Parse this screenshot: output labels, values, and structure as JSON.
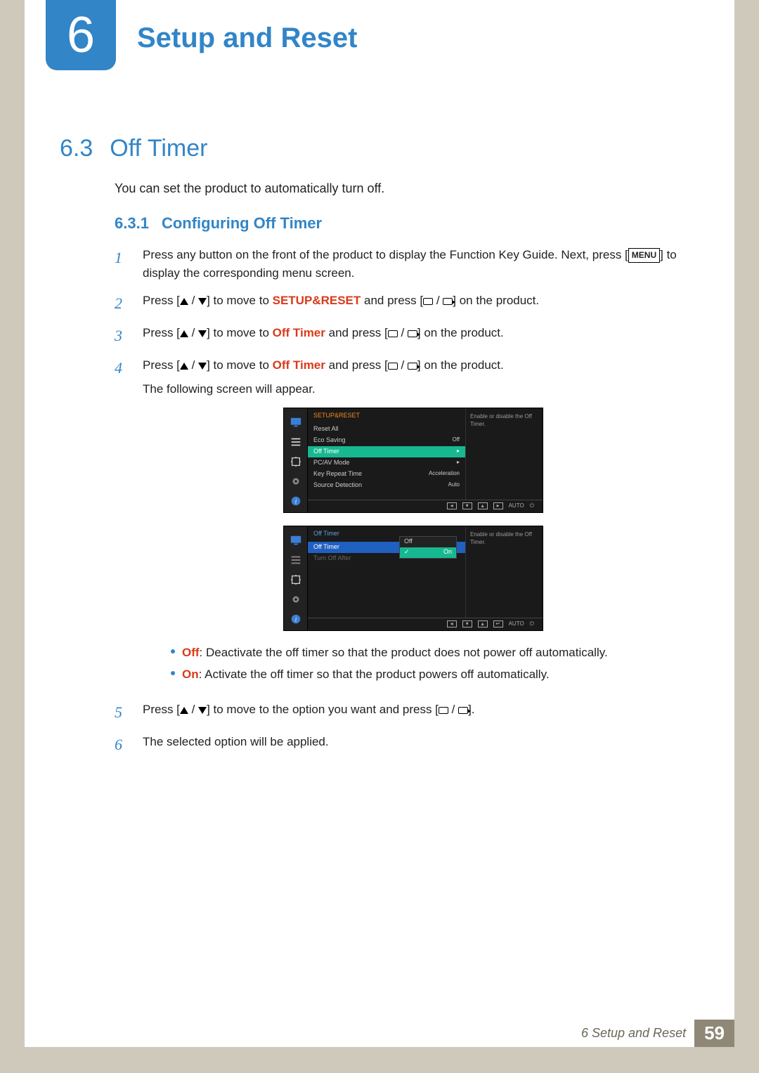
{
  "chapter": {
    "number": "6",
    "title": "Setup and Reset"
  },
  "section": {
    "number": "6.3",
    "title": "Off Timer",
    "intro": "You can set the product to automatically turn off."
  },
  "subsection": {
    "number": "6.3.1",
    "title": "Configuring Off Timer"
  },
  "buttons": {
    "menu": "MENU"
  },
  "steps": {
    "s1_a": "Press any button on the front of the product to display the Function Key Guide. Next, press [",
    "s1_b": "] to display the corresponding menu screen.",
    "s2_a": "Press [",
    "s2_b": "] to move to ",
    "s2_target": "SETUP&RESET",
    "s2_c": " and press [",
    "s2_d": "] on the product.",
    "s3_a": "Press [",
    "s3_b": "] to move to ",
    "s3_target": "Off Timer",
    "s3_c": " and press [",
    "s3_d": "] on the product.",
    "s4_a": "Press [",
    "s4_b": "] to move to ",
    "s4_target": "Off Timer",
    "s4_c": " and press [",
    "s4_d": "] on the product.",
    "s4_follow": "The following screen will appear.",
    "s5_a": "Press [",
    "s5_b": "] to move to the option you want and press [",
    "s5_c": "].",
    "s6": "The selected option will be applied."
  },
  "osd1": {
    "header": "SETUP&RESET",
    "items": [
      {
        "label": "Reset All",
        "value": ""
      },
      {
        "label": "Eco Saving",
        "value": "Off"
      },
      {
        "label": "Off Timer",
        "value": "▸",
        "selected": true
      },
      {
        "label": "PC/AV Mode",
        "value": "▸"
      },
      {
        "label": "Key Repeat Time",
        "value": "Acceleration"
      },
      {
        "label": "Source Detection",
        "value": "Auto"
      }
    ],
    "help": "Enable or disable the Off Timer.",
    "footer_auto": "AUTO"
  },
  "osd2": {
    "header": "Off Timer",
    "items": [
      {
        "label": "Off Timer",
        "value": "",
        "selected": true
      },
      {
        "label": "Turn Off After",
        "value": "",
        "dim": true
      }
    ],
    "options": [
      {
        "label": "Off"
      },
      {
        "label": "On",
        "selected": true
      }
    ],
    "help": "Enable or disable the Off Timer.",
    "footer_auto": "AUTO"
  },
  "bullets": {
    "off_label": "Off",
    "off_text": ": Deactivate the off timer so that the product does not power off automatically.",
    "on_label": "On",
    "on_text": ": Activate the off timer so that the product powers off automatically."
  },
  "footer": {
    "chapter_ref": "6 Setup and Reset",
    "page": "59"
  }
}
